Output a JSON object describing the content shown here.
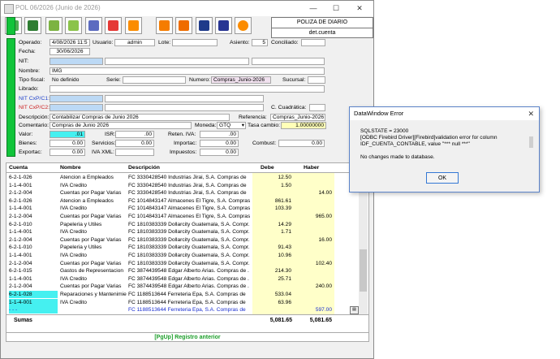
{
  "window": {
    "title": "POL 06/2026 (Junio de 2026)",
    "minimize": "—",
    "maximize": "☐",
    "close": "✕"
  },
  "toolbar": {
    "buttons": [
      {
        "name": "save-icon",
        "color": "#4caf50"
      },
      {
        "name": "download-icon",
        "color": "#2e7d32"
      },
      {
        "name": "pen-icon",
        "color": "#7cb342"
      },
      {
        "name": "user-icon",
        "color": "#8bc34a"
      },
      {
        "name": "calculator-icon",
        "color": "#5c6bc0"
      },
      {
        "name": "delete-icon",
        "color": "#e53935"
      },
      {
        "name": "report-icon",
        "color": "#fb8c00"
      },
      {
        "name": "print-icon",
        "color": "#f57c00"
      },
      {
        "name": "print-preview-icon",
        "color": "#ef6c00"
      },
      {
        "name": "fel-icon",
        "color": "#1e3a8a"
      },
      {
        "name": "export-icon",
        "color": "#283593"
      },
      {
        "name": "help-icon",
        "color": "#fb8c00"
      }
    ]
  },
  "header": {
    "tipo": "POLIZA DE DIARIO",
    "vista": "det.cuenta"
  },
  "form": {
    "operado_label": "Operado:",
    "operado": "4/08/2026 11:5",
    "usuario_label": "Usuario:",
    "usuario": "admin",
    "lote_label": "Lote:",
    "lote": "",
    "asiento_label": "Asiento:",
    "asiento": "5",
    "conciliado_label": "Conciliado:",
    "conciliado": "",
    "fecha_label": "Fecha:",
    "fecha": "30/06/2026",
    "nit_label": "NIT:",
    "nit": "",
    "nombre_label": "Nombre:",
    "nombre": "IMG",
    "tipo_fiscal_label": "Tipo fiscal:",
    "tipo_fiscal": "No definido",
    "serie_label": "Serie:",
    "serie": "",
    "numero_label": "Numero:",
    "numero": "Compras_Junio-2026",
    "sucursal_label": "Sucursal:",
    "sucursal": "",
    "librado_label": "Librado:",
    "librado": "",
    "nit_cxp1_label": "NIT CxP/C1:",
    "nit_cxp2_label": "NIT CxP/C2:",
    "c_cuadratica_label": "C. Cuadrática:",
    "descripcion_label": "Descripción:",
    "descripcion": "Contabilizar Compras de Junio 2026",
    "referencia_label": "Referencia:",
    "referencia": "Compras_Junio-2026",
    "comentario_label": "Comentario:",
    "comentario": "Compras de Junio 2026",
    "moneda_label": "Moneda:",
    "moneda": "GTQ",
    "tasa_label": "Tasa cambio:",
    "tasa": "1.00000000",
    "valor_label": "Valor:",
    "valor": ".01",
    "isr_label": "ISR:",
    "isr": ".00",
    "reten_iva_label": "Reten. IVA:",
    "reten_iva": ".00",
    "bienes_label": "Bienes:",
    "bienes": "0.00",
    "servicios_label": "Servicios:",
    "servicios": "0.00",
    "importac_label": "Importac:",
    "importac": "0.00",
    "combust_label": "Combust:",
    "combust": "0.00",
    "exportac_label": "Exportac:",
    "exportac": "0.00",
    "iva_xml_label": "IVA XML:",
    "iva_xml": "",
    "impuestos_label": "Impuestos:",
    "impuestos": "0.00"
  },
  "grid": {
    "headers": {
      "cuenta": "Cuenta",
      "nombre": "Nombre",
      "descripcion": "Descripción",
      "debe": "Debe",
      "haber": "Haber"
    },
    "rows": [
      {
        "cuenta": "6-2-1-026",
        "nombre": "Atencion a Empleados",
        "descripcion": "FC 3330428540 Industrias Jirai, S.A. Compras de",
        "debe": "12.50",
        "haber": ""
      },
      {
        "cuenta": "1-1-4-001",
        "nombre": "IVA Credito",
        "descripcion": "FC 3330428540 Industrias Jirai, S.A. Compras de",
        "debe": "1.50",
        "haber": ""
      },
      {
        "cuenta": "2-1-2-004",
        "nombre": "Cuentas por Pagar Varias",
        "descripcion": "FC 3330428540 Industrias Jirai, S.A. Compras de",
        "debe": "",
        "haber": "14.00"
      },
      {
        "cuenta": "6-2-1-026",
        "nombre": "Atencion a Empleados",
        "descripcion": "FC 1014843147 Almacenes El Tigre, S.A. Compras",
        "debe": "861.61",
        "haber": ""
      },
      {
        "cuenta": "1-1-4-001",
        "nombre": "IVA Credito",
        "descripcion": "FC 1014843147 Almacenes El Tigre, S.A. Compras",
        "debe": "103.39",
        "haber": ""
      },
      {
        "cuenta": "2-1-2-004",
        "nombre": "Cuentas por Pagar Varias",
        "descripcion": "FC 1014843147 Almacenes El Tigre, S.A. Compras",
        "debe": "",
        "haber": "965.00"
      },
      {
        "cuenta": "6-2-1-010",
        "nombre": "Papeleria y Utiles",
        "descripcion": "FC 1810383339 Dollarcity Guatemala, S.A. Compr.",
        "debe": "14.29",
        "haber": ""
      },
      {
        "cuenta": "1-1-4-001",
        "nombre": "IVA Credito",
        "descripcion": "FC 1810383339 Dollarcity Guatemala, S.A. Compr.",
        "debe": "1.71",
        "haber": ""
      },
      {
        "cuenta": "2-1-2-004",
        "nombre": "Cuentas por Pagar Varias",
        "descripcion": "FC 1810383339 Dollarcity Guatemala, S.A. Compr.",
        "debe": "",
        "haber": "16.00"
      },
      {
        "cuenta": "6-2-1-010",
        "nombre": "Papeleria y Utiles",
        "descripcion": "FC 1810383339 Dollarcity Guatemala, S.A. Compr.",
        "debe": "91.43",
        "haber": ""
      },
      {
        "cuenta": "1-1-4-001",
        "nombre": "IVA Credito",
        "descripcion": "FC 1810383339 Dollarcity Guatemala, S.A. Compr.",
        "debe": "10.96",
        "haber": ""
      },
      {
        "cuenta": "2-1-2-004",
        "nombre": "Cuentas por Pagar Varias",
        "descripcion": "FC 1810383339 Dollarcity Guatemala, S.A. Compr.",
        "debe": "",
        "haber": "102.40"
      },
      {
        "cuenta": "6-2-1-015",
        "nombre": "Gastos de Representacion",
        "descripcion": "FC 3874439548 Edgar Alberto Arias. Compras de .",
        "debe": "214.30",
        "haber": ""
      },
      {
        "cuenta": "1-1-4-001",
        "nombre": "IVA Credito",
        "descripcion": "FC 3874439548 Edgar Alberto Arias. Compras de .",
        "debe": "25.71",
        "haber": ""
      },
      {
        "cuenta": "2-1-2-004",
        "nombre": "Cuentas por Pagar Varias",
        "descripcion": "FC 3874439548 Edgar Alberto Arias. Compras de .",
        "debe": "",
        "haber": "240.00"
      },
      {
        "cuenta": "6-2-1-028",
        "nombre": "Reparaciones y Mantenimier",
        "descripcion": "FC 1188513644 Ferreteria Epa, S.A. Compras de",
        "debe": "533.04",
        "haber": ""
      },
      {
        "cuenta": "1-1-4-001",
        "nombre": "IVA Credito",
        "descripcion": "FC 1188513644 Ferreteria Epa, S.A. Compras de",
        "debe": "63.96",
        "haber": ""
      },
      {
        "cuenta": "- - -",
        "nombre": "",
        "descripcion": "FC 1188513644 Ferreteria Epa, S.A. Compras de",
        "debe": "",
        "haber": "597.00"
      }
    ],
    "sumas_label": "Sumas",
    "sum_debe": "5,081.65",
    "sum_haber": "5,081.65"
  },
  "status": {
    "text": "[PgUp] Registro anterior"
  },
  "dialog": {
    "title": "DataWindow Error",
    "close": "✕",
    "lines": [
      "SQLSTATE = 23000",
      "[ODBC Firebird Driver][Firebird]validation error for column",
      "IDF_CUENTA_CONTABLE, value \"*** null ***\""
    ],
    "message": "No changes made to database.",
    "ok_label": "OK"
  }
}
